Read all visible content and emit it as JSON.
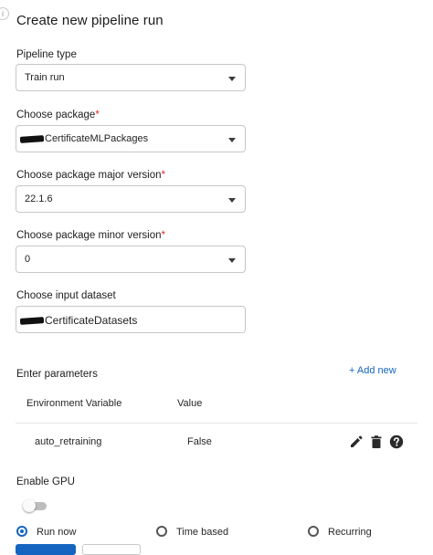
{
  "form": {
    "title": "Create new pipeline run",
    "pipeline_type": {
      "label": "Pipeline type",
      "value": "Train run"
    },
    "package": {
      "label": "Choose package",
      "required_mark": "*",
      "value": "CertificateMLPackages"
    },
    "major_version": {
      "label": "Choose package major version",
      "required_mark": "*",
      "value": "22.1.6"
    },
    "minor_version": {
      "label": "Choose package minor version",
      "required_mark": "*",
      "value": "0"
    },
    "dataset": {
      "label": "Choose input dataset",
      "value": "CertificateDatasets"
    }
  },
  "parameters": {
    "section_label": "Enter parameters",
    "add_new_label": "+ Add new",
    "columns": [
      "Environment Variable",
      "Value"
    ],
    "rows": [
      {
        "variable": "auto_retraining",
        "value": "False",
        "icons": [
          "pencil-icon",
          "trash-icon",
          "help-icon"
        ]
      }
    ]
  },
  "gpu": {
    "label": "Enable GPU",
    "enabled": false
  },
  "schedule": {
    "options": [
      "Run now",
      "Time based",
      "Recurring"
    ],
    "selected": "Run now"
  },
  "colors": {
    "accent": "#1565c0",
    "required": "#d32f2f",
    "icon": "#2b2b2b"
  }
}
